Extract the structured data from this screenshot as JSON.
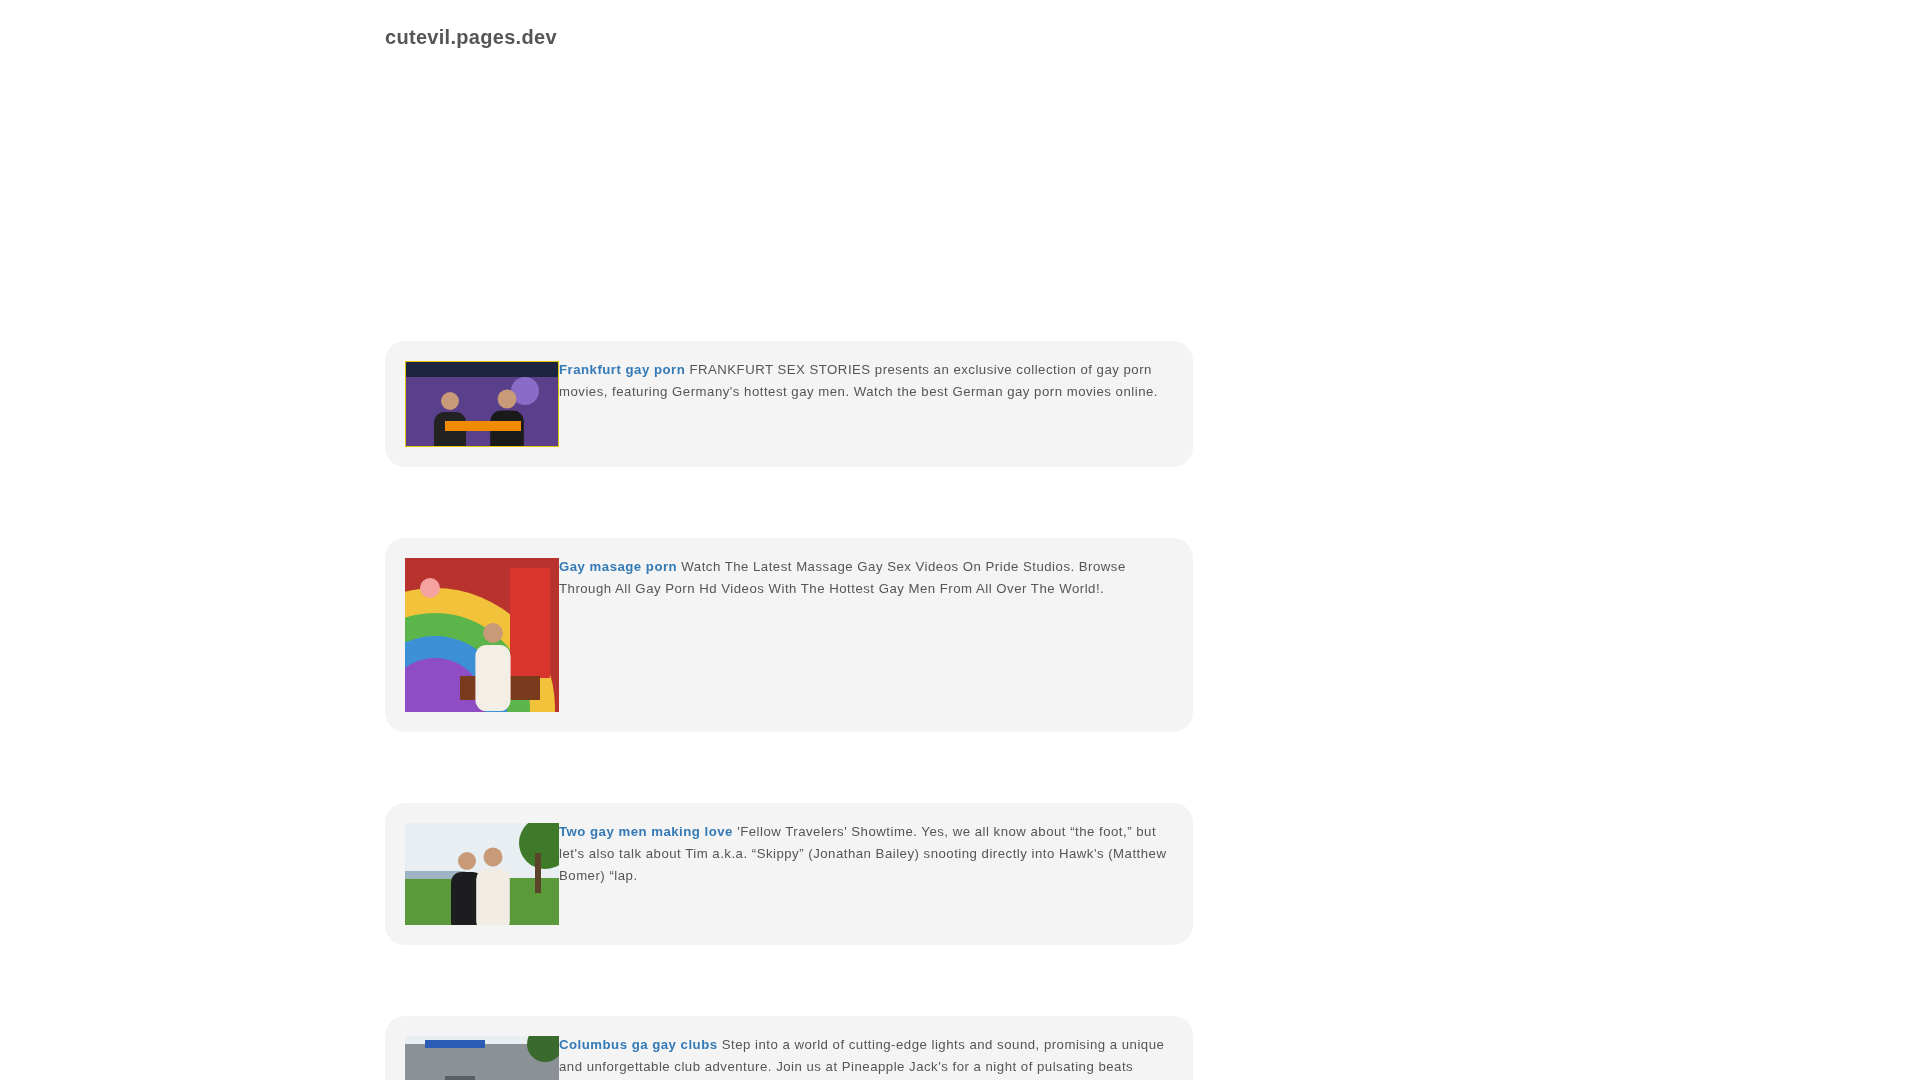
{
  "site_title": "cutevil.pages.dev",
  "posts": [
    {
      "title": "Frankfurt gay porn",
      "text": "FRANKFURT SEX STORIES presents an exclusive collection of gay porn movies, featuring Germany's hottest gay men. Watch the best German gay porn movies online.",
      "thumbnail": {
        "kind": "banner"
      }
    },
    {
      "title": "Gay masage porn",
      "text": "Watch The Latest Massage Gay Sex Videos On Pride Studios. Browse Through All Gay Porn Hd Videos With The Hottest Gay Men From All Over The World!.",
      "thumbnail": {
        "kind": "room"
      }
    },
    {
      "title": "Two gay men making love",
      "text": "'Fellow Travelers' Showtime. Yes, we all know about “the foot,” but let's also talk about Tim a.k.a. “Skippy” (Jonathan Bailey) snooting directly into Hawk's (Matthew Bomer) “lap.",
      "thumbnail": {
        "kind": "park"
      }
    },
    {
      "title": "Columbus ga gay clubs",
      "text": "Step into a world of cutting-edge lights and sound, promising a unique and unforgettable club adventure. Join us at Pineapple Jack's for a night of pulsating beats",
      "thumbnail": {
        "kind": "street"
      }
    }
  ]
}
